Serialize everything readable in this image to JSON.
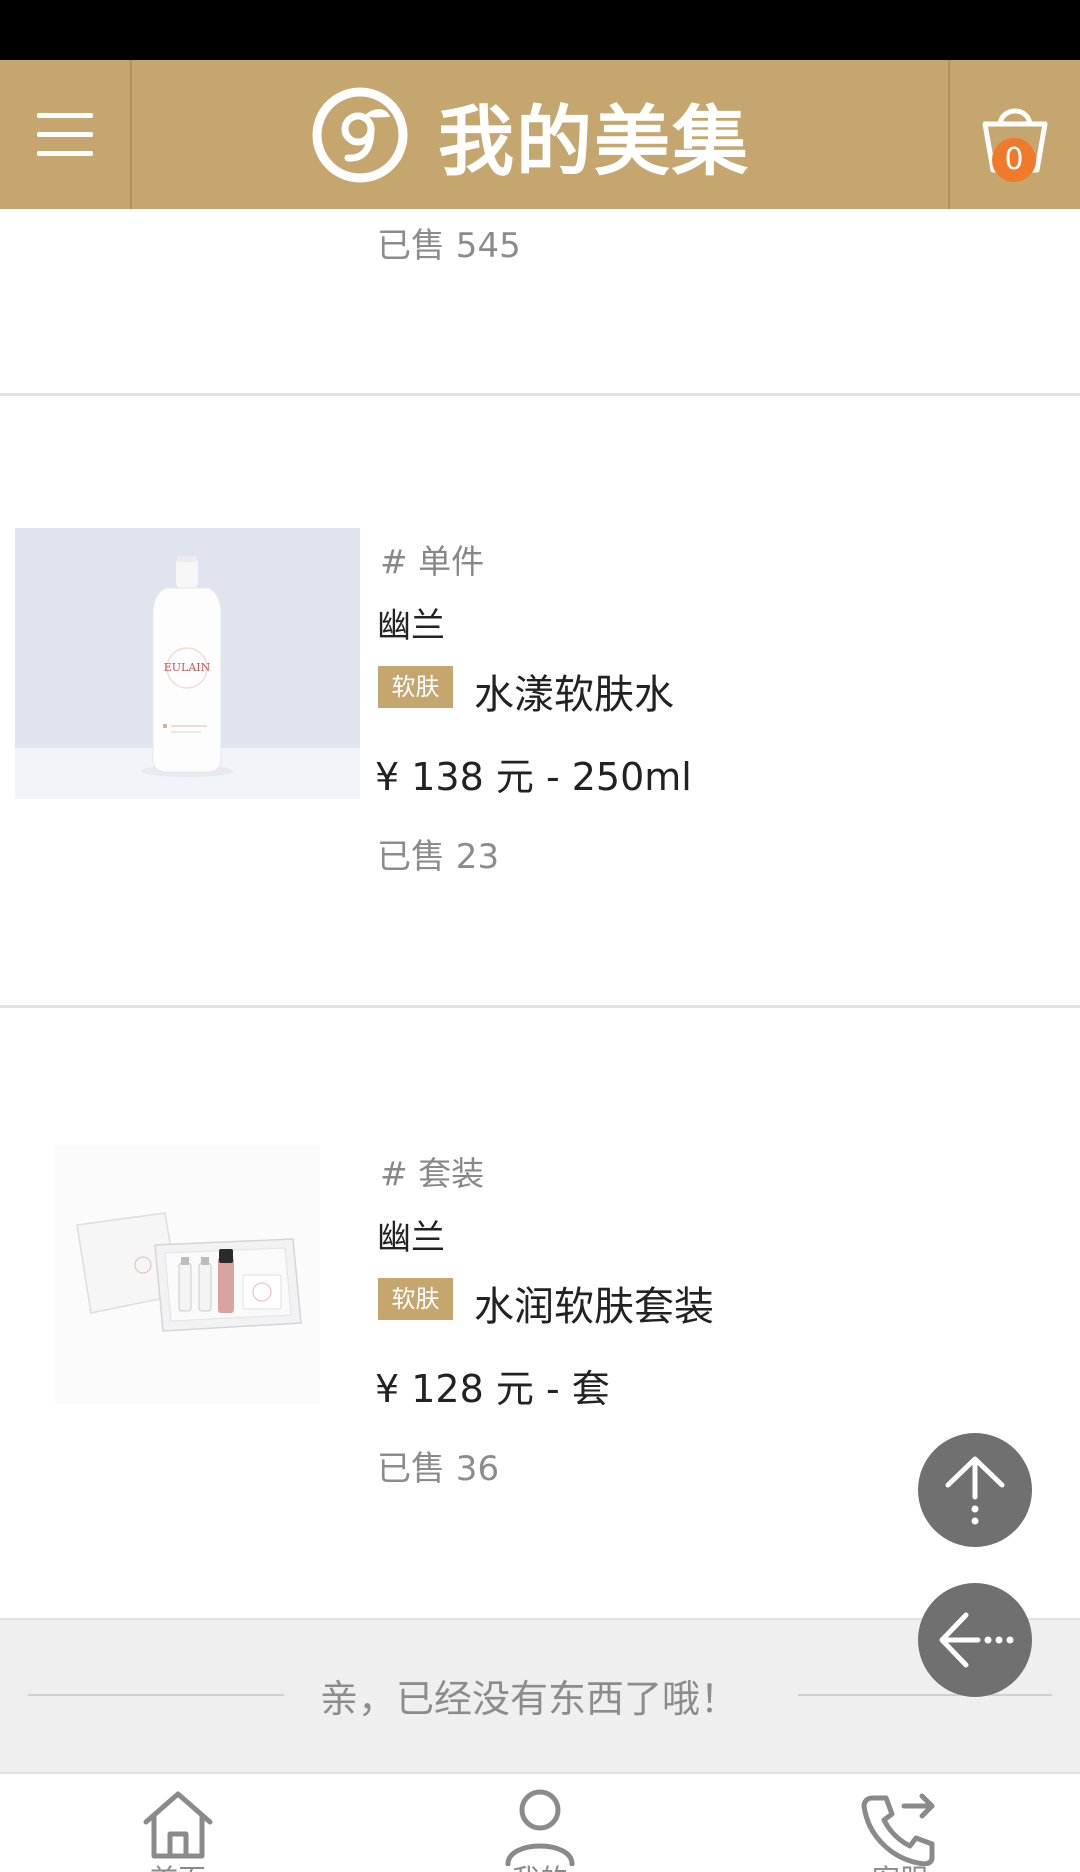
{
  "header": {
    "title": "我的美集",
    "cart_count": "0",
    "brand_color": "#c5a66e"
  },
  "products": [
    {
      "sold": "已售 545"
    },
    {
      "category": "# 单件",
      "brand": "幽兰",
      "tag": "软肤",
      "name": "水漾软肤水",
      "price": "¥ 138 元 - 250ml",
      "sold": "已售 23",
      "image_text": "EULAIN"
    },
    {
      "category": "# 套装",
      "brand": "幽兰",
      "tag": "软肤",
      "name": "水润软肤套装",
      "price": "¥ 128 元 - 套",
      "sold": "已售 36"
    }
  ],
  "footer": {
    "end_message": "亲，已经没有东西了哦！"
  },
  "icons": {
    "menu": "menu-icon",
    "logo": "brand-logo-icon",
    "cart": "shopping-bag-icon",
    "scroll_top": "arrow-up-icon",
    "back": "arrow-left-icon",
    "home": "home-icon",
    "profile": "user-icon",
    "contact": "phone-forward-icon"
  },
  "nav": [
    {
      "label": "首页"
    },
    {
      "label": "我的"
    },
    {
      "label": "客服"
    }
  ]
}
